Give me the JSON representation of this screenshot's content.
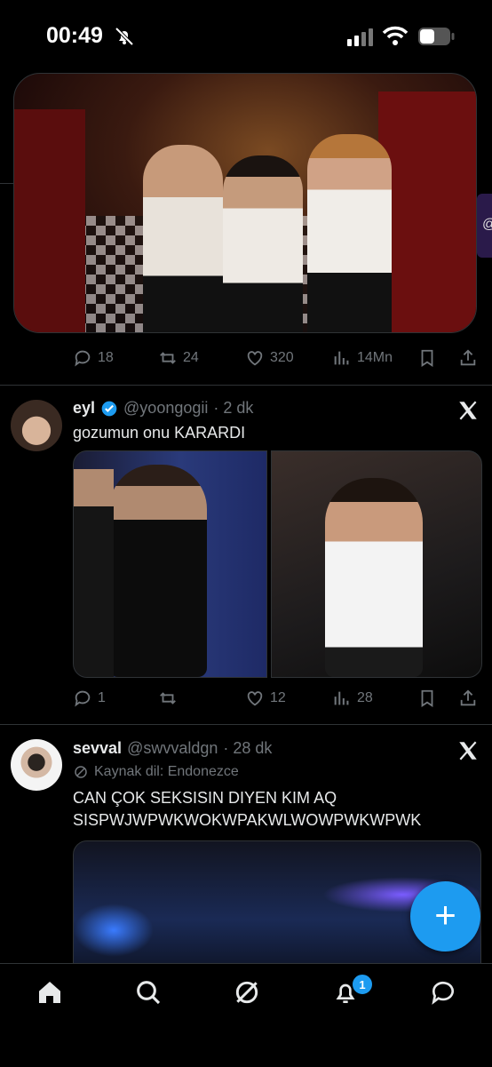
{
  "status_bar": {
    "time": "00:49"
  },
  "top_post": {
    "reply_count": "18",
    "repost_count": "24",
    "like_count": "320",
    "view_count": "14Mn"
  },
  "post1": {
    "name": "eyl",
    "handle": "@yoongogii",
    "time": "· 2 dk",
    "text": "gozumun onu KARARDI",
    "reply_count": "1",
    "repost_count": "",
    "like_count": "12",
    "view_count": "28"
  },
  "post2": {
    "name": "sevval",
    "handle": "@swvvaldgn",
    "time": "· 28 dk",
    "translation": "Kaynak dil: Endonezce",
    "text_line1": "CAN ÇOK SEKSISIN DIYEN KIM AQ",
    "text_line2": "SISPWJWPWKWOKWPAKWLWOWPWKWPWK"
  },
  "side_peek": "@",
  "fab": {
    "label": "+"
  },
  "nav": {
    "notification_badge": "1"
  },
  "colors": {
    "accent": "#1d9bf0",
    "background": "#000000",
    "muted": "#71767b"
  }
}
